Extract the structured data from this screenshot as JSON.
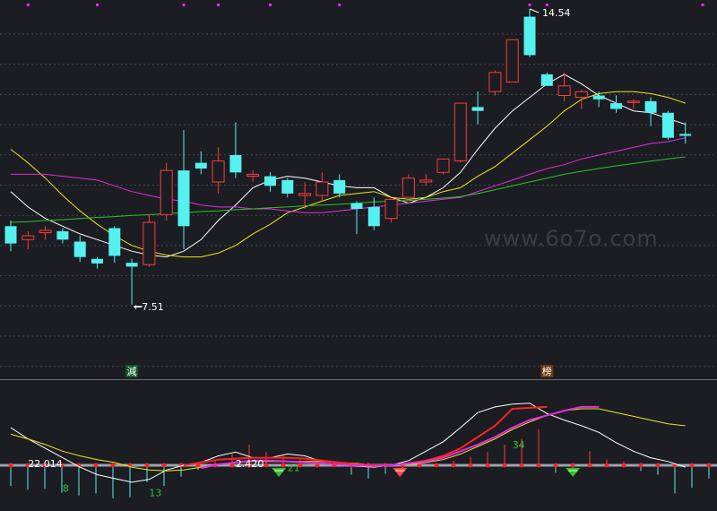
{
  "chart_data": [
    {
      "type": "candlestick",
      "panel": "price",
      "grid": true,
      "ylim": [
        6.2,
        15.2
      ],
      "candles": [
        {
          "o": 9.55,
          "h": 9.7,
          "l": 8.9,
          "c": 9.1
        },
        {
          "o": 9.2,
          "h": 9.42,
          "l": 8.95,
          "c": 9.3
        },
        {
          "o": 9.38,
          "h": 9.55,
          "l": 9.2,
          "c": 9.44
        },
        {
          "o": 9.42,
          "h": 9.5,
          "l": 9.1,
          "c": 9.2
        },
        {
          "o": 9.15,
          "h": 9.3,
          "l": 8.62,
          "c": 8.75
        },
        {
          "o": 8.7,
          "h": 8.75,
          "l": 8.45,
          "c": 8.58
        },
        {
          "o": 9.5,
          "h": 9.55,
          "l": 8.6,
          "c": 8.78
        },
        {
          "o": 8.6,
          "h": 8.7,
          "l": 7.51,
          "c": 8.5
        },
        {
          "o": 8.55,
          "h": 9.85,
          "l": 8.5,
          "c": 9.65
        },
        {
          "o": 9.85,
          "h": 11.2,
          "l": 9.7,
          "c": 11.0
        },
        {
          "o": 11.0,
          "h": 12.05,
          "l": 8.95,
          "c": 9.55
        },
        {
          "o": 11.2,
          "h": 11.5,
          "l": 10.9,
          "c": 11.05
        },
        {
          "o": 10.7,
          "h": 11.6,
          "l": 10.4,
          "c": 11.25
        },
        {
          "o": 11.4,
          "h": 12.25,
          "l": 10.8,
          "c": 10.95
        },
        {
          "o": 10.85,
          "h": 11.0,
          "l": 10.7,
          "c": 10.9
        },
        {
          "o": 10.85,
          "h": 10.95,
          "l": 10.45,
          "c": 10.6
        },
        {
          "o": 10.75,
          "h": 10.8,
          "l": 10.3,
          "c": 10.4
        },
        {
          "o": 10.35,
          "h": 10.7,
          "l": 10.0,
          "c": 10.4
        },
        {
          "o": 10.35,
          "h": 10.95,
          "l": 10.2,
          "c": 10.7
        },
        {
          "o": 10.75,
          "h": 10.9,
          "l": 10.3,
          "c": 10.4
        },
        {
          "o": 10.15,
          "h": 10.2,
          "l": 9.35,
          "c": 10.0
        },
        {
          "o": 10.05,
          "h": 10.3,
          "l": 9.45,
          "c": 9.55
        },
        {
          "o": 9.75,
          "h": 10.25,
          "l": 9.65,
          "c": 10.25
        },
        {
          "o": 10.3,
          "h": 10.9,
          "l": 10.3,
          "c": 10.8
        },
        {
          "o": 10.7,
          "h": 10.9,
          "l": 10.6,
          "c": 10.75
        },
        {
          "o": 10.95,
          "h": 11.3,
          "l": 10.9,
          "c": 11.3
        },
        {
          "o": 11.25,
          "h": 12.75,
          "l": 11.2,
          "c": 12.75
        },
        {
          "o": 12.65,
          "h": 13.05,
          "l": 12.2,
          "c": 12.55
        },
        {
          "o": 13.05,
          "h": 13.6,
          "l": 12.95,
          "c": 13.55
        },
        {
          "o": 13.3,
          "h": 14.35,
          "l": 13.3,
          "c": 14.4
        },
        {
          "o": 15.0,
          "h": 15.2,
          "l": 13.95,
          "c": 14.0
        },
        {
          "o": 13.5,
          "h": 13.55,
          "l": 13.2,
          "c": 13.2
        },
        {
          "o": 12.95,
          "h": 13.55,
          "l": 12.8,
          "c": 13.2
        },
        {
          "o": 12.9,
          "h": 13.1,
          "l": 12.6,
          "c": 13.05
        },
        {
          "o": 12.95,
          "h": 13.05,
          "l": 12.65,
          "c": 12.85
        },
        {
          "o": 12.75,
          "h": 12.95,
          "l": 12.5,
          "c": 12.6
        },
        {
          "o": 12.8,
          "h": 12.85,
          "l": 12.6,
          "c": 12.8
        },
        {
          "o": 12.8,
          "h": 12.9,
          "l": 12.15,
          "c": 12.5
        },
        {
          "o": 12.5,
          "h": 12.55,
          "l": 11.8,
          "c": 11.85
        },
        {
          "o": 11.95,
          "h": 12.25,
          "l": 11.7,
          "c": 11.9
        }
      ],
      "moving_averages": [
        {
          "color": "#ffffff",
          "values": [
            10.45,
            10.05,
            9.75,
            9.55,
            9.35,
            9.2,
            9.05,
            8.9,
            8.8,
            8.75,
            8.9,
            9.2,
            9.7,
            10.1,
            10.55,
            10.75,
            10.85,
            10.8,
            10.7,
            10.6,
            10.55,
            10.55,
            10.3,
            10.15,
            10.3,
            10.55,
            10.95,
            11.55,
            12.1,
            12.55,
            12.9,
            13.25,
            13.5,
            13.25,
            12.95,
            12.75,
            12.55,
            12.5,
            12.35,
            12.2
          ]
        },
        {
          "color": "#f0e51a",
          "values": [
            11.55,
            11.2,
            10.8,
            10.35,
            9.95,
            9.6,
            9.3,
            9.05,
            8.9,
            8.8,
            8.75,
            8.75,
            8.85,
            9.05,
            9.35,
            9.6,
            9.9,
            10.05,
            10.2,
            10.35,
            10.4,
            10.45,
            10.3,
            10.25,
            10.3,
            10.45,
            10.55,
            10.85,
            11.1,
            11.45,
            11.8,
            12.15,
            12.55,
            12.85,
            13.0,
            13.05,
            13.05,
            13.0,
            12.9,
            12.75
          ]
        },
        {
          "color": "#e42ddf",
          "values": [
            10.9,
            10.9,
            10.9,
            10.85,
            10.8,
            10.75,
            10.6,
            10.45,
            10.35,
            10.25,
            10.2,
            10.1,
            10.05,
            10.05,
            10.0,
            10.0,
            9.95,
            9.9,
            9.9,
            9.95,
            10.0,
            10.05,
            10.1,
            10.15,
            10.2,
            10.25,
            10.3,
            10.45,
            10.6,
            10.75,
            10.9,
            11.05,
            11.15,
            11.3,
            11.4,
            11.5,
            11.6,
            11.7,
            11.75,
            11.85
          ]
        },
        {
          "color": "#2ec32b",
          "values": [
            9.65,
            9.67,
            9.7,
            9.72,
            9.75,
            9.78,
            9.8,
            9.83,
            9.85,
            9.88,
            9.9,
            9.93,
            9.95,
            9.98,
            10.0,
            10.03,
            10.05,
            10.08,
            10.1,
            10.12,
            10.15,
            10.18,
            10.2,
            10.22,
            10.25,
            10.28,
            10.32,
            10.4,
            10.5,
            10.6,
            10.7,
            10.8,
            10.9,
            10.98,
            11.05,
            11.12,
            11.18,
            11.24,
            11.3,
            11.35
          ]
        }
      ],
      "annotations": [
        {
          "text": "14.54",
          "index": 30,
          "value": 15.2,
          "kind": "high"
        },
        {
          "text": "7.51",
          "index": 7,
          "value": 7.51,
          "kind": "low"
        }
      ],
      "markers": [
        {
          "text": "減",
          "index": 7,
          "bg": "#0f5a28",
          "fg": "#ffffff"
        },
        {
          "text": "榜",
          "index": 31,
          "bg": "#6a3a0f",
          "fg": "#ffffff"
        }
      ],
      "top_dots_at": [
        1,
        5,
        10,
        12,
        15,
        19,
        30,
        31,
        40
      ],
      "watermark": "www.6o7o.com"
    },
    {
      "type": "indicator",
      "panel": "oscillator",
      "ylim": [
        -55,
        75
      ],
      "zero": 0,
      "bars": [
        -22,
        -26,
        -25,
        -29,
        -32,
        -30,
        -35,
        -34,
        -18,
        -22,
        -12,
        -5,
        5,
        12,
        22,
        14,
        10,
        6,
        4,
        3,
        -10,
        -14,
        -9,
        -6,
        -2,
        2,
        5,
        9,
        14,
        22,
        28,
        38,
        -8,
        -4,
        15,
        6,
        4,
        -6,
        -10,
        -30,
        -24,
        -14
      ],
      "lines": [
        {
          "color": "#ffffff",
          "values": [
            40,
            28,
            18,
            8,
            -2,
            -10,
            -14,
            -18,
            -15,
            -5,
            0,
            3,
            10,
            14,
            8,
            8,
            12,
            10,
            4,
            3,
            -1,
            -2,
            0,
            5,
            15,
            25,
            40,
            56,
            62,
            65,
            66,
            55,
            48,
            42,
            35,
            24,
            15,
            8,
            4,
            -2
          ]
        },
        {
          "color": "#f0e51a",
          "values": [
            33,
            28,
            22,
            15,
            10,
            6,
            3,
            -2,
            -5,
            -6,
            -5,
            -2,
            1,
            3,
            4,
            4,
            4,
            4,
            4,
            3,
            2,
            0,
            0,
            1,
            3,
            6,
            12,
            20,
            28,
            38,
            46,
            53,
            58,
            60,
            60,
            56,
            52,
            48,
            44,
            42
          ]
        },
        {
          "color": "#ff2222",
          "values": [
            null,
            null,
            null,
            null,
            null,
            null,
            null,
            null,
            null,
            null,
            0,
            3,
            6,
            7,
            8,
            8,
            8,
            7,
            5,
            3,
            1,
            0,
            0,
            2,
            5,
            10,
            18,
            30,
            42,
            60,
            61,
            62,
            null,
            null,
            null,
            null,
            null,
            null,
            null,
            null
          ]
        },
        {
          "color": "#e42ddf",
          "values": [
            null,
            null,
            null,
            null,
            null,
            null,
            null,
            null,
            null,
            null,
            null,
            -3,
            1,
            3,
            5,
            5,
            4,
            3,
            2,
            1,
            0,
            -1,
            0,
            2,
            4,
            8,
            15,
            22,
            30,
            40,
            48,
            53,
            58,
            62,
            62,
            null,
            null,
            null,
            null,
            null
          ]
        }
      ],
      "labels": [
        {
          "text": "22.014",
          "index": 1,
          "value": -2,
          "color": "#ffffff"
        },
        {
          "text": "8",
          "index": 3,
          "value": -28,
          "color": "#2ec32b"
        },
        {
          "text": "13",
          "index": 8,
          "value": -33,
          "color": "#2ec32b"
        },
        {
          "text": "2.420",
          "index": 13,
          "value": -2,
          "color": "#ffffff"
        },
        {
          "text": "21",
          "index": 16,
          "value": -6,
          "color": "#2ec32b"
        },
        {
          "text": "34",
          "index": 29,
          "value": 18,
          "color": "#2ec32b"
        }
      ],
      "signals": [
        {
          "index": 15.5,
          "color": "#2ec32b"
        },
        {
          "index": 22.5,
          "color": "#ff4a4a"
        },
        {
          "index": 32.5,
          "color": "#2ec32b"
        }
      ]
    }
  ],
  "colors": {
    "background": "#1b1d22",
    "grid": "#3e4552",
    "up": "#ff3b3b",
    "down": "#55f0f0",
    "axis_line": "#9aa3ad"
  }
}
